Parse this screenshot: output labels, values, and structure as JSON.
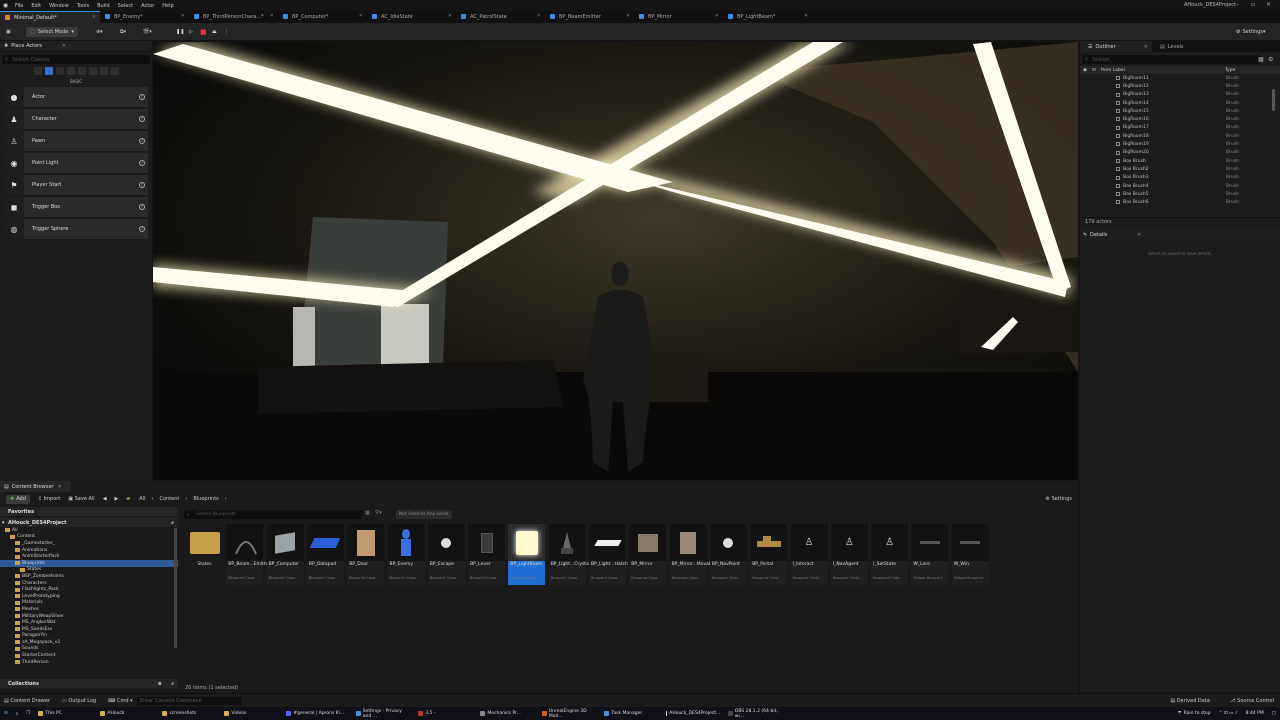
{
  "menubar": {
    "items": [
      "File",
      "Edit",
      "Window",
      "Tools",
      "Build",
      "Select",
      "Actor",
      "Help"
    ],
    "project_name": "AHouck_DES4Project"
  },
  "tabs": [
    {
      "label": "Minimal_Default*",
      "color": "#d88a2a",
      "active": true
    },
    {
      "label": "BP_Enemy*",
      "color": "#3a8fe0"
    },
    {
      "label": "BP_ThirdPersonChara...*",
      "color": "#3a8fe0"
    },
    {
      "label": "BP_Computer*",
      "color": "#3a8fe0"
    },
    {
      "label": "AC_IdleState",
      "color": "#3a8fe0"
    },
    {
      "label": "AC_PatrolState",
      "color": "#3a8fe0"
    },
    {
      "label": "BP_BeamEmitter",
      "color": "#3a8fe0"
    },
    {
      "label": "BP_Mirror",
      "color": "#3a8fe0"
    },
    {
      "label": "BP_LightBeam*",
      "color": "#3a8fe0"
    }
  ],
  "toolbar": {
    "select_mode": "Select Mode",
    "settings": "Settings"
  },
  "place_actors": {
    "title": "Place Actors",
    "search_placeholder": "Search Classes",
    "category": "BASIC",
    "actors": [
      {
        "label": "Actor",
        "icon": "sphere-icon"
      },
      {
        "label": "Character",
        "icon": "character-icon"
      },
      {
        "label": "Pawn",
        "icon": "pawn-icon"
      },
      {
        "label": "Point Light",
        "icon": "light-bulb-icon"
      },
      {
        "label": "Player Start",
        "icon": "player-start-icon"
      },
      {
        "label": "Trigger Box",
        "icon": "trigger-box-icon"
      },
      {
        "label": "Trigger Sphere",
        "icon": "trigger-sphere-icon"
      }
    ]
  },
  "outliner": {
    "tab_outliner": "Outliner",
    "tab_levels": "Levels",
    "search_placeholder": "Search",
    "col_label": "Item Label",
    "col_type": "Type",
    "rows": [
      {
        "name": "BigRoom11",
        "type": "Brush"
      },
      {
        "name": "BigRoom12",
        "type": "Brush"
      },
      {
        "name": "BigRoom13",
        "type": "Brush"
      },
      {
        "name": "BigRoom14",
        "type": "Brush"
      },
      {
        "name": "BigRoom15",
        "type": "Brush"
      },
      {
        "name": "BigRoom16",
        "type": "Brush"
      },
      {
        "name": "BigRoom17",
        "type": "Brush"
      },
      {
        "name": "BigRoom18",
        "type": "Brush"
      },
      {
        "name": "BigRoom19",
        "type": "Brush"
      },
      {
        "name": "BigRoom20",
        "type": "Brush"
      },
      {
        "name": "Box Brush",
        "type": "Brush"
      },
      {
        "name": "Box Brush2",
        "type": "Brush"
      },
      {
        "name": "Box Brush3",
        "type": "Brush"
      },
      {
        "name": "Box Brush4",
        "type": "Brush"
      },
      {
        "name": "Box Brush5",
        "type": "Brush"
      },
      {
        "name": "Box Brush6",
        "type": "Brush"
      }
    ],
    "actor_count": "179 actors"
  },
  "details": {
    "title": "Details",
    "message": "Select an object to view details."
  },
  "content_browser": {
    "title": "Content Browser",
    "add": "Add",
    "import": "Import",
    "save_all": "Save All",
    "breadcrumb": [
      "All",
      "Content",
      "Blueprints"
    ],
    "settings": "Settings",
    "favorites": "Favorites",
    "project": "AHouck_DES4Project",
    "search_placeholder": "Search Blueprints",
    "filter_chip": "Not Used In Any Level",
    "tree": [
      {
        "label": "All",
        "indent": 1
      },
      {
        "label": "Content",
        "indent": 2
      },
      {
        "label": "_Gamestarter_",
        "indent": 3
      },
      {
        "label": "Animations",
        "indent": 3
      },
      {
        "label": "AnimStarterPack",
        "indent": 3
      },
      {
        "label": "Blueprints",
        "indent": 3,
        "selected": true
      },
      {
        "label": "States",
        "indent": 4
      },
      {
        "label": "BSP_ZombieAnims",
        "indent": 3
      },
      {
        "label": "Characters",
        "indent": 3
      },
      {
        "label": "Flashlights_Pack",
        "indent": 3
      },
      {
        "label": "LevelPrototyping",
        "indent": 3
      },
      {
        "label": "Materials",
        "indent": 3
      },
      {
        "label": "Meshes",
        "indent": 3
      },
      {
        "label": "MilitaryWeapSilver",
        "indent": 3
      },
      {
        "label": "MS_AngkorWat",
        "indent": 3
      },
      {
        "label": "MS_SandsEss",
        "indent": 3
      },
      {
        "label": "ParagonYin",
        "indent": 3
      },
      {
        "label": "sA_Megapack_v1",
        "indent": 3
      },
      {
        "label": "Sounds",
        "indent": 3
      },
      {
        "label": "StarterContent",
        "indent": 3
      },
      {
        "label": "ThirdPerson",
        "indent": 3
      }
    ],
    "collections": "Collections",
    "assets": [
      {
        "name": "States",
        "type": "",
        "kind": "folder"
      },
      {
        "name": "BP_Beam...Emitter",
        "type": "Blueprint Class",
        "kind": "beam"
      },
      {
        "name": "BP_Computer",
        "type": "Blueprint Class",
        "kind": "computer"
      },
      {
        "name": "BP_Datapad",
        "type": "Blueprint Class",
        "kind": "datapad"
      },
      {
        "name": "BP_Door",
        "type": "Blueprint Class",
        "kind": "door"
      },
      {
        "name": "BP_Enemy",
        "type": "Blueprint Class",
        "kind": "enemy"
      },
      {
        "name": "BP_Escape",
        "type": "Blueprint Class",
        "kind": "sphere"
      },
      {
        "name": "BP_Lever",
        "type": "Blueprint Class",
        "kind": "lever"
      },
      {
        "name": "BP_LightBeam",
        "type": "Blueprint Class",
        "kind": "lightbeam",
        "selected": true
      },
      {
        "name": "BP_Light...Crystal",
        "type": "Blueprint Class",
        "kind": "crystal"
      },
      {
        "name": "BP_Light...Hatch",
        "type": "Blueprint Class",
        "kind": "hatch"
      },
      {
        "name": "BP_Mirror",
        "type": "Blueprint Class",
        "kind": "mirror"
      },
      {
        "name": "BP_Mirror...Movable",
        "type": "Blueprint Class",
        "kind": "mirror2"
      },
      {
        "name": "BP_NavPoint",
        "type": "Blueprint Class",
        "kind": "sphere"
      },
      {
        "name": "BP_Portal",
        "type": "Blueprint Class",
        "kind": "portal"
      },
      {
        "name": "I_Interact",
        "type": "Blueprint Class",
        "kind": "interface"
      },
      {
        "name": "I_NavAgent",
        "type": "Blueprint Class",
        "kind": "interface"
      },
      {
        "name": "I_SetState",
        "type": "Blueprint Class",
        "kind": "interface"
      },
      {
        "name": "W_Lore",
        "type": "Widget Blueprint",
        "kind": "widget"
      },
      {
        "name": "W_Win",
        "type": "Widget Blueprint",
        "kind": "widget"
      }
    ],
    "item_count": "20 items (1 selected)"
  },
  "statusbar": {
    "content_drawer": "Content Drawer",
    "output_log": "Output Log",
    "cmd": "Cmd",
    "console_placeholder": "Enter Console Command",
    "derived_data": "Derived Data",
    "source_control": "Source Control"
  },
  "taskbar": {
    "items": [
      {
        "label": "This PC",
        "color": "#d4b24a"
      },
      {
        "label": "AHouck",
        "color": "#d4b24a"
      },
      {
        "label": "screenshots",
        "color": "#d4b24a"
      },
      {
        "label": "Videos",
        "color": "#d4b24a"
      },
      {
        "label": "#general | Aprons Ki...",
        "color": "#5865f2"
      },
      {
        "label": "Settings - Privacy and ...",
        "color": "#4a90d9"
      },
      {
        "label": "3.5 - ",
        "color": "#c03030"
      },
      {
        "label": "Mechanics Pr...",
        "color": "#888888"
      },
      {
        "label": "UnrealEngine 3D Mod...",
        "color": "#d06020"
      },
      {
        "label": "Task Manager",
        "color": "#4a90d9"
      },
      {
        "label": "AHouck_DES4Project...",
        "color": "#dddddd"
      },
      {
        "label": "OBS 28.1.2 (64-bit, wi...",
        "color": "#444444"
      }
    ],
    "weather": "Rain to stop",
    "time": "8:44 PM"
  }
}
